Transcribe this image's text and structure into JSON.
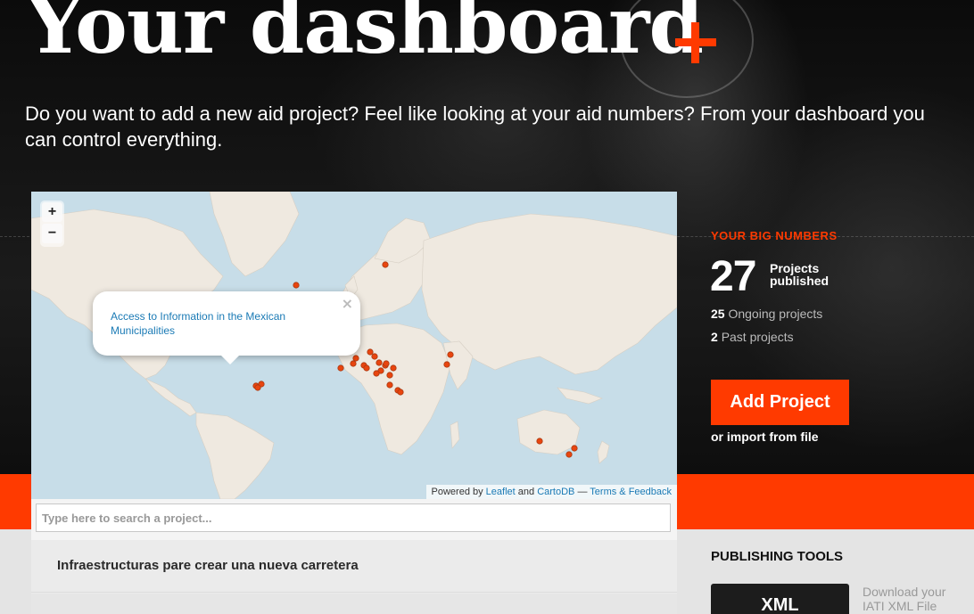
{
  "header": {
    "title": "Your dashboard",
    "intro": "Do you want to add a new aid project? Feel like looking at your aid numbers? From your dashboard you can control everything."
  },
  "map": {
    "zoom_in": "+",
    "zoom_out": "−",
    "popup_text": "Access to Information in the Mexican Municipalities",
    "popup_close": "×",
    "attribution": {
      "powered_by": "Powered by",
      "leaflet": "Leaflet",
      "and": "and",
      "cartodb": "CartoDB",
      "dash": "—",
      "terms": "Terms & Feedback"
    },
    "marker_color": "#e8450f"
  },
  "search": {
    "placeholder": "Type here to search a project..."
  },
  "projects": [
    {
      "name": "Infraestructuras pare crear una nueva carretera"
    }
  ],
  "big_numbers": {
    "title": "YOUR BIG NUMBERS",
    "published_count": "27",
    "published_label": "Projects published",
    "ongoing_count": "25",
    "ongoing_label": "Ongoing projects",
    "past_count": "2",
    "past_label": "Past projects"
  },
  "actions": {
    "add_project": "Add Project",
    "import": "or import from file"
  },
  "publishing": {
    "title": "PUBLISHING TOOLS",
    "xml_button": "XML",
    "xml_desc": "Download your IATI XML File"
  },
  "colors": {
    "accent": "#ff3a00",
    "link": "#1a7ab5"
  }
}
